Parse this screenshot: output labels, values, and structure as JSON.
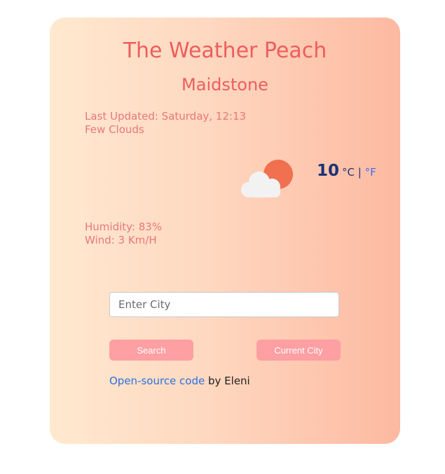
{
  "app": {
    "title": "The Weather Peach"
  },
  "weather": {
    "city": "Maidstone",
    "last_updated": "Last Updated: Saturday, 12:13",
    "description": "Few Clouds",
    "temperature": "10",
    "unit_celsius": "°C",
    "unit_separator": " | ",
    "unit_fahrenheit": "°F",
    "humidity": "Humidity: 83%",
    "wind": "Wind: 3 Km/H",
    "icon": "few-clouds-day-icon"
  },
  "search": {
    "placeholder": "Enter City",
    "value": "",
    "search_label": "Search",
    "current_city_label": "Current City"
  },
  "footer": {
    "link_text": "Open-source code",
    "suffix": " by Eleni"
  },
  "colors": {
    "accent": "#ec5e5e",
    "button": "#fd9fa3",
    "link": "#2f6fe0",
    "temperature": "#1c3276"
  }
}
